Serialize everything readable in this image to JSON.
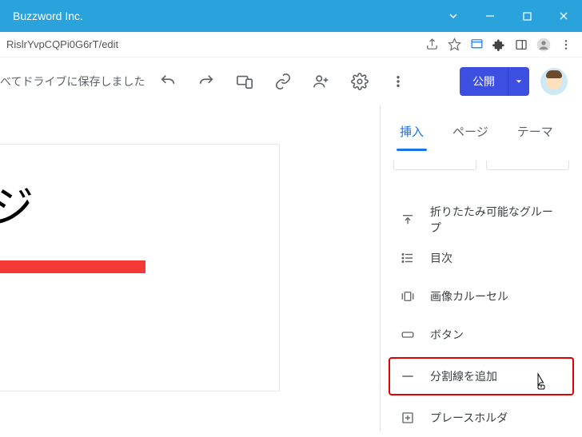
{
  "window": {
    "title": "Buzzword Inc."
  },
  "addressbar": {
    "url": "RislrYvpCQPi0G6rT/edit"
  },
  "toolbar": {
    "save_status": "べてドライブに保存しました",
    "publish_label": "公開"
  },
  "canvas": {
    "heading": "ジ"
  },
  "tabs": {
    "insert": "挿入",
    "page": "ページ",
    "theme": "テーマ"
  },
  "insert_items": {
    "collapsible": "折りたたみ可能なグループ",
    "toc": "目次",
    "carousel": "画像カルーセル",
    "button": "ボタン",
    "divider": "分割線を追加",
    "placeholder": "プレースホルダ"
  }
}
